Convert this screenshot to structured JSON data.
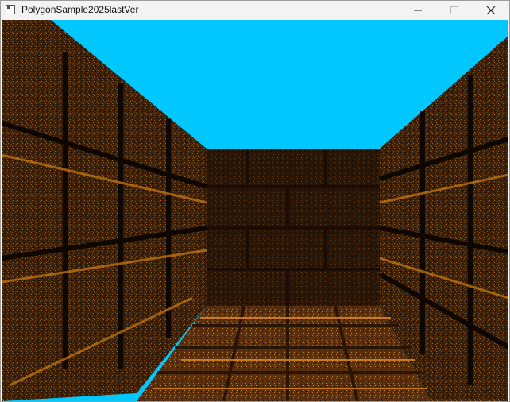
{
  "window": {
    "title": "PolygonSample2025lastVer",
    "icon": "app-window-icon",
    "controls": [
      "minimize-icon",
      "maximize-icon",
      "close-icon"
    ]
  },
  "scene": {
    "sky_color": "#00c8ff",
    "wall_color": "#4a2a10",
    "highlight_color": "#c8780f",
    "shadow_color": "#140a02"
  }
}
